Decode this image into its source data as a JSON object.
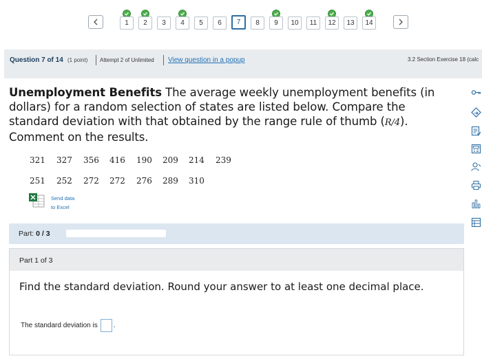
{
  "pager": {
    "prev_label": "<",
    "next_label": ">",
    "questions": [
      {
        "num": "1",
        "done": true
      },
      {
        "num": "2",
        "done": true
      },
      {
        "num": "3",
        "done": false
      },
      {
        "num": "4",
        "done": true
      },
      {
        "num": "5",
        "done": false
      },
      {
        "num": "6",
        "done": false
      },
      {
        "num": "7",
        "done": false,
        "current": true
      },
      {
        "num": "8",
        "done": false
      },
      {
        "num": "9",
        "done": true
      },
      {
        "num": "10",
        "done": false
      },
      {
        "num": "11",
        "done": false
      },
      {
        "num": "12",
        "done": true
      },
      {
        "num": "13",
        "done": false
      },
      {
        "num": "14",
        "done": true
      }
    ]
  },
  "header": {
    "title": "Question 7 of 14",
    "points": "(1 point)",
    "attempt": "Attempt 2 of Unlimited",
    "popup_link": "View question in a popup",
    "section": "3.2 Section Exercise 18 (calc"
  },
  "question": {
    "bold_title": "Unemployment Benefits",
    "text_before_math": " The average weekly unemployment benefits (in dollars) for a random selection of states are listed below. Compare the standard deviation with that obtained by the range rule of thumb (",
    "math": "R/4",
    "text_after_math": "). Comment on the results."
  },
  "data": {
    "row1": [
      "321",
      "327",
      "356",
      "416",
      "190",
      "209",
      "214",
      "239"
    ],
    "row2": [
      "251",
      "252",
      "272",
      "272",
      "276",
      "289",
      "310"
    ]
  },
  "excel": {
    "line1": "Send data",
    "line2": "to Excel"
  },
  "parts": {
    "label": "Part:",
    "progress": "0 / 3",
    "progress_fraction": 0.0,
    "current_part": "Part 1 of 3"
  },
  "prompt": {
    "text": "Find the standard deviation. Round your answer to at least one decimal place.",
    "answer_label": "The standard deviation is",
    "answer_value": "",
    "answer_suffix": "."
  },
  "tools": [
    "key-icon",
    "diamond-arrow-icon",
    "form-check-icon",
    "calculator-icon",
    "person-search-icon",
    "print-icon",
    "bar-chart-icon",
    "grid-doc-icon"
  ],
  "colors": {
    "accent": "#2d6da3",
    "check": "#4cae4c",
    "link": "#1f6fb5",
    "header_bg": "#e8ecef",
    "part_bar_bg": "#dbe6f0"
  }
}
